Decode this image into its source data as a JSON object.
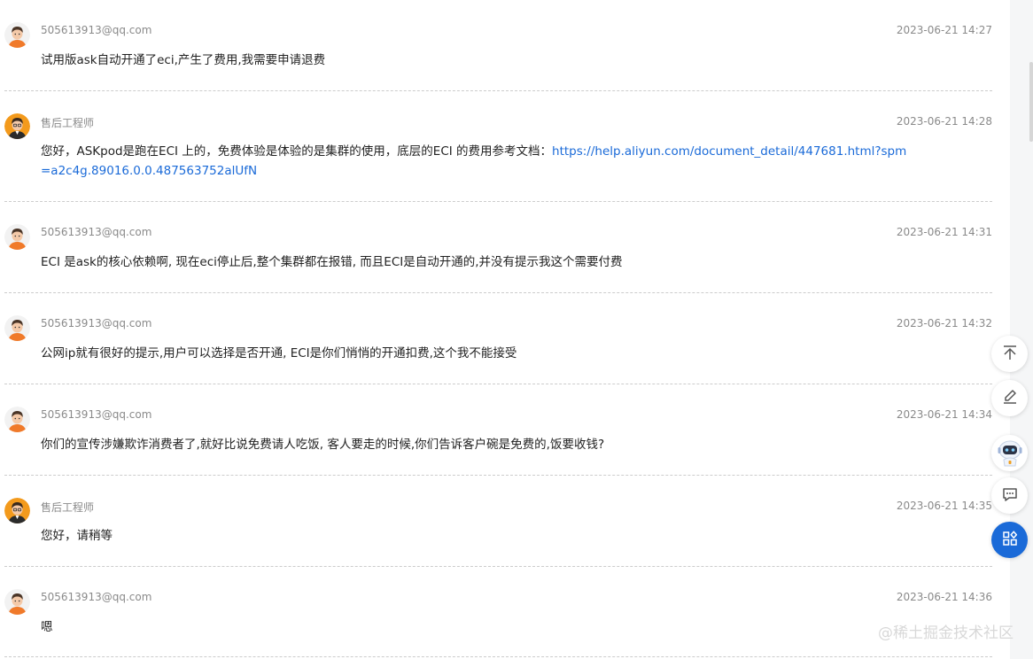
{
  "messages": [
    {
      "sender": "505613913@qq.com",
      "time": "2023-06-21 14:27",
      "text": "试用版ask自动开通了eci,产生了费用,我需要申请退费",
      "avatar": "user-avatar"
    },
    {
      "sender": "售后工程师",
      "time": "2023-06-21 14:28",
      "text": "您好，ASKpod是跑在ECI 上的，免费体验是体验的是集群的使用，底层的ECI 的费用参考文档：",
      "link": "https://help.aliyun.com/document_detail/447681.html?spm=a2c4g.89016.0.0.487563752alUfN",
      "avatar": "engineer-avatar"
    },
    {
      "sender": "505613913@qq.com",
      "time": "2023-06-21 14:31",
      "text": "ECI 是ask的核心依赖啊, 现在eci停止后,整个集群都在报错, 而且ECI是自动开通的,并没有提示我这个需要付费",
      "avatar": "user-avatar"
    },
    {
      "sender": "505613913@qq.com",
      "time": "2023-06-21 14:32",
      "text": "公网ip就有很好的提示,用户可以选择是否开通, ECI是你们悄悄的开通扣费,这个我不能接受",
      "avatar": "user-avatar"
    },
    {
      "sender": "505613913@qq.com",
      "time": "2023-06-21 14:34",
      "text": "你们的宣传涉嫌欺诈消费者了,就好比说免费请人吃饭, 客人要走的时候,你们告诉客户碗是免费的,饭要收钱?",
      "avatar": "user-avatar"
    },
    {
      "sender": "售后工程师",
      "time": "2023-06-21 14:35",
      "text": "您好，请稍等",
      "avatar": "engineer-avatar"
    },
    {
      "sender": "505613913@qq.com",
      "time": "2023-06-21 14:36",
      "text": "嗯",
      "avatar": "user-avatar"
    }
  ],
  "side_tools": [
    {
      "name": "back-to-top-icon"
    },
    {
      "name": "edit-icon"
    },
    {
      "name": "assistant-robot-icon"
    },
    {
      "name": "chat-icon"
    },
    {
      "name": "apps-grid-icon"
    }
  ],
  "watermark": "@稀土掘金技术社区",
  "colors": {
    "link": "#1a6ad8",
    "primary_button": "#1a6ad8",
    "meta_text": "#8a8a8a",
    "body_text": "#222222"
  }
}
